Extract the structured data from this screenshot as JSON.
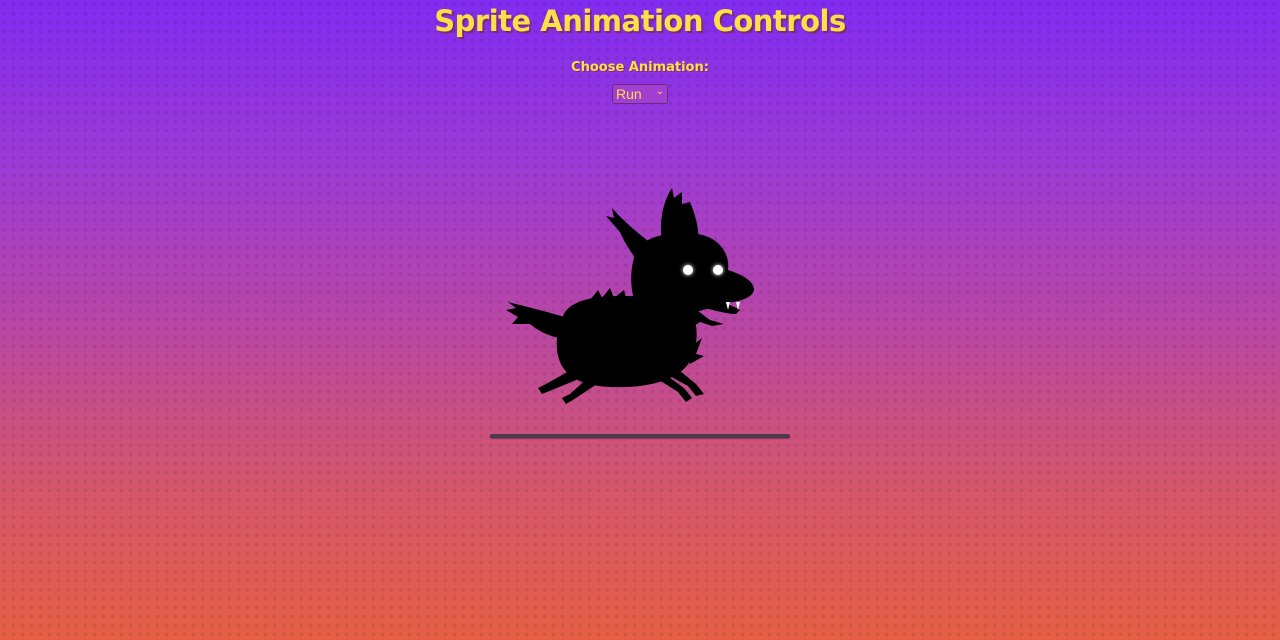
{
  "page": {
    "title": "Sprite Animation Controls"
  },
  "controls": {
    "animation_label": "Choose Animation:",
    "animation_select": {
      "selected": "Run",
      "options": [
        "Run"
      ]
    }
  },
  "sprite": {
    "subject": "black shadow wolf with glowing white eyes",
    "current_animation": "Run"
  },
  "colors": {
    "title": "#fde047",
    "background_top": "#812cf0",
    "background_bottom": "#e65f45",
    "sprite": "#000000",
    "eyes": "#ffffff",
    "ground": "#4a3a4c"
  },
  "icons": {
    "select_chevron": "chevron-down-icon"
  }
}
